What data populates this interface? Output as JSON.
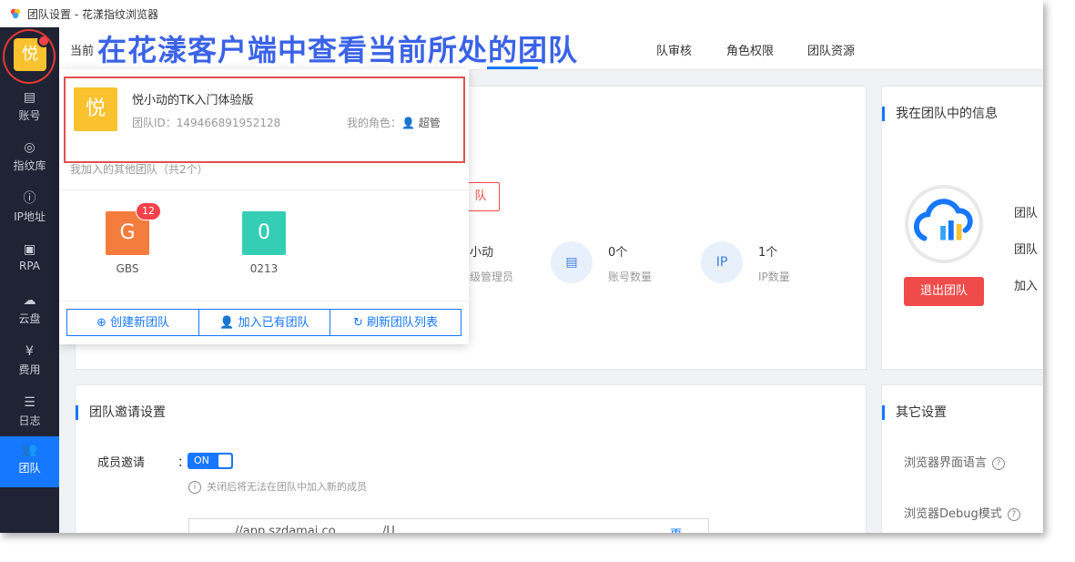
{
  "window": {
    "title": "团队设置 - 花漾指纹浏览器"
  },
  "annotation": "在花漾客户端中查看当前所处的团队",
  "sidebar": {
    "avatar_char": "悦",
    "items": [
      {
        "label": "账号",
        "icon": "account-card-icon"
      },
      {
        "label": "指纹库",
        "icon": "fingerprint-icon"
      },
      {
        "label": "IP地址",
        "icon": "ip-icon"
      },
      {
        "label": "RPA",
        "icon": "robot-icon"
      },
      {
        "label": "云盘",
        "icon": "cloud-disk-icon"
      },
      {
        "label": "费用",
        "icon": "yen-icon"
      },
      {
        "label": "日志",
        "icon": "log-icon"
      },
      {
        "label": "团队",
        "icon": "team-icon"
      }
    ],
    "active": "团队"
  },
  "topnav": {
    "left_partial": "当前",
    "tabs": [
      "队审核",
      "角色权限",
      "团队资源"
    ]
  },
  "popup": {
    "current_team": {
      "avatar_char": "悦",
      "name": "悦小动的TK入门体验版",
      "id_label": "团队ID：",
      "id": "149466891952128",
      "role_label": "我的角色：",
      "role": "超管"
    },
    "others_label": "我加入的其他团队（共2个）",
    "other_teams": [
      {
        "char": "G",
        "name": "GBS",
        "badge": "12",
        "color": "#f47c3c"
      },
      {
        "char": "0",
        "name": "0213",
        "badge": "",
        "color": "#36cdb5"
      }
    ],
    "buttons": {
      "create": "创建新团队",
      "join": "加入已有团队",
      "refresh": "刷新团队列表"
    }
  },
  "main_card": {
    "partial_button": "队",
    "owner_name": "小动",
    "owner_role": "级管理员",
    "stats": [
      {
        "value": "0个",
        "label": "账号数量",
        "icon": "id-card-icon"
      },
      {
        "value": "1个",
        "label": "IP数量",
        "icon": "ip-icon"
      }
    ]
  },
  "my_info": {
    "title": "我在团队中的信息",
    "rows": [
      "团队",
      "团队",
      "加入"
    ],
    "leave_button": "退出团队"
  },
  "invite": {
    "title": "团队邀请设置",
    "member_invite_label": "成员邀请",
    "colon": "：",
    "toggle_text": "ON",
    "hint": "关闭后将无法在团队中加入新的成员",
    "link_partial": "//app.szdamai.co",
    "link_partial2": "/U",
    "link_action": "更"
  },
  "other_settings": {
    "title": "其它设置",
    "rows": [
      "浏览器界面语言",
      "浏览器Debug模式"
    ]
  },
  "colors": {
    "accent": "#1677ff",
    "danger": "#f04b4b",
    "sidebar": "#1f2333",
    "avatar": "#f9c22e"
  }
}
